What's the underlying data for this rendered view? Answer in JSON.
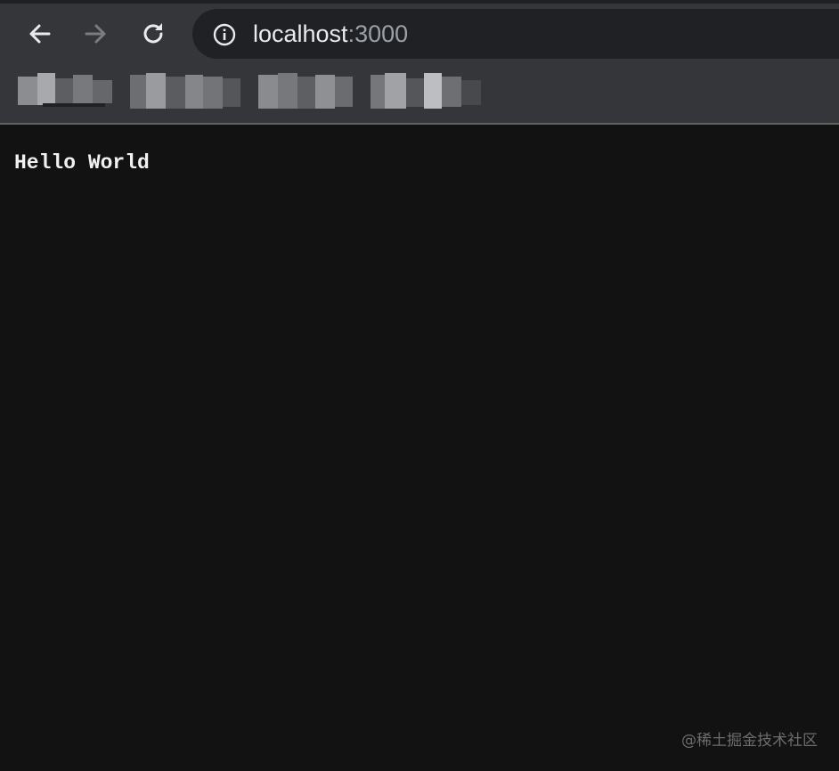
{
  "browser": {
    "url_host": "localhost",
    "url_port": ":3000",
    "icons": {
      "back": "back-arrow-icon",
      "forward": "forward-arrow-icon",
      "reload": "reload-icon",
      "site_info": "info-icon"
    },
    "bookmarks_count_visible": 4,
    "colors": {
      "chrome": "#35363a",
      "omnibox": "#202124",
      "page_bg": "#121213",
      "text": "#e8eaed",
      "muted": "#9aa0a6"
    }
  },
  "page": {
    "body_text": "Hello World"
  },
  "watermark": {
    "text": "@稀土掘金技术社区"
  }
}
